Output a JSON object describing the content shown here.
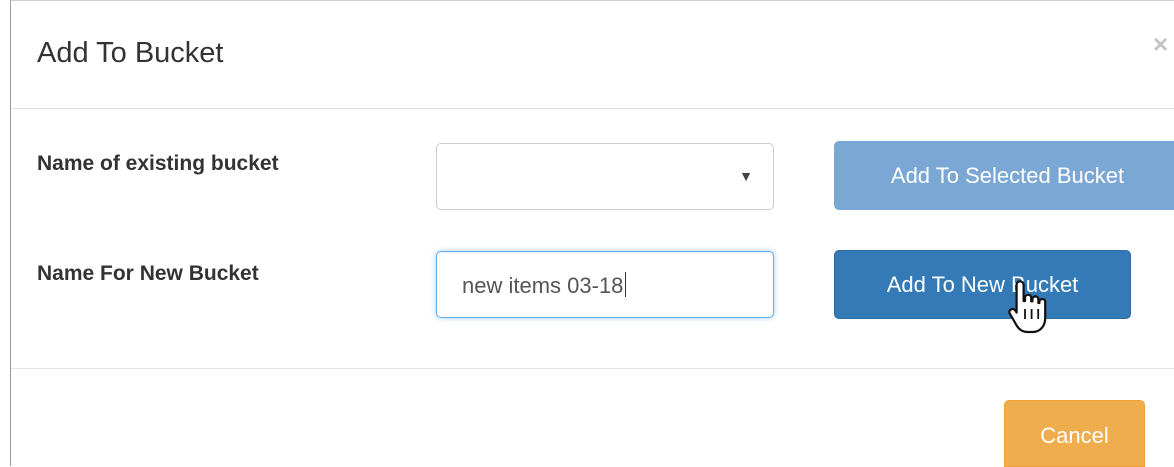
{
  "dialog": {
    "title": "Add To Bucket",
    "close_symbol": "×"
  },
  "form": {
    "existing_bucket_label": "Name of existing bucket",
    "existing_bucket_selected": "",
    "new_bucket_label": "Name For New Bucket",
    "new_bucket_value": "new items 03-18"
  },
  "buttons": {
    "add_to_selected": "Add To Selected Bucket",
    "add_to_new": "Add To New Bucket",
    "cancel": "Cancel"
  },
  "icons": {
    "select_caret": "chevron-down-icon",
    "cursor": "hand-pointer-icon",
    "close": "close-icon"
  },
  "colors": {
    "primary": "#337ab7",
    "primary_disabled": "#7ba7d4",
    "warning": "#f0ad4e",
    "focus_border": "#66afe9"
  }
}
